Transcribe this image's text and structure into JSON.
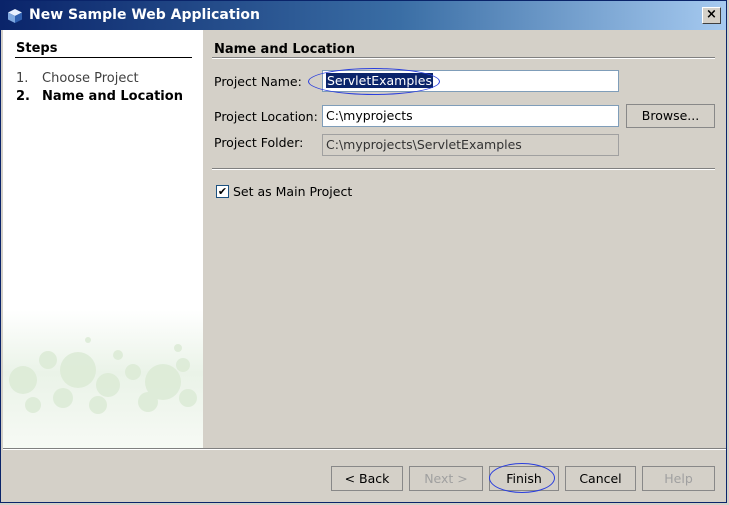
{
  "window": {
    "title": "New Sample Web Application",
    "close_label": "×"
  },
  "steps": {
    "heading": "Steps",
    "items": [
      {
        "num": "1.",
        "label": "Choose Project"
      },
      {
        "num": "2.",
        "label": "Name and Location"
      }
    ]
  },
  "panel": {
    "heading": "Name and Location",
    "project_name_label": "Project Name:",
    "project_name_value": "ServletExamples",
    "project_location_label": "Project Location:",
    "project_location_value": "C:\\myprojects",
    "browse_label": "Browse...",
    "project_folder_label": "Project Folder:",
    "project_folder_value": "C:\\myprojects\\ServletExamples",
    "main_project_label": "Set as Main Project",
    "main_project_checked": true
  },
  "buttons": {
    "back": "< Back",
    "next": "Next >",
    "finish": "Finish",
    "cancel": "Cancel",
    "help": "Help"
  },
  "colors": {
    "title_bar": "#0a246a",
    "selection": "#0a246a",
    "annotation": "#2b3fdd",
    "background": "#d4d0c8"
  }
}
